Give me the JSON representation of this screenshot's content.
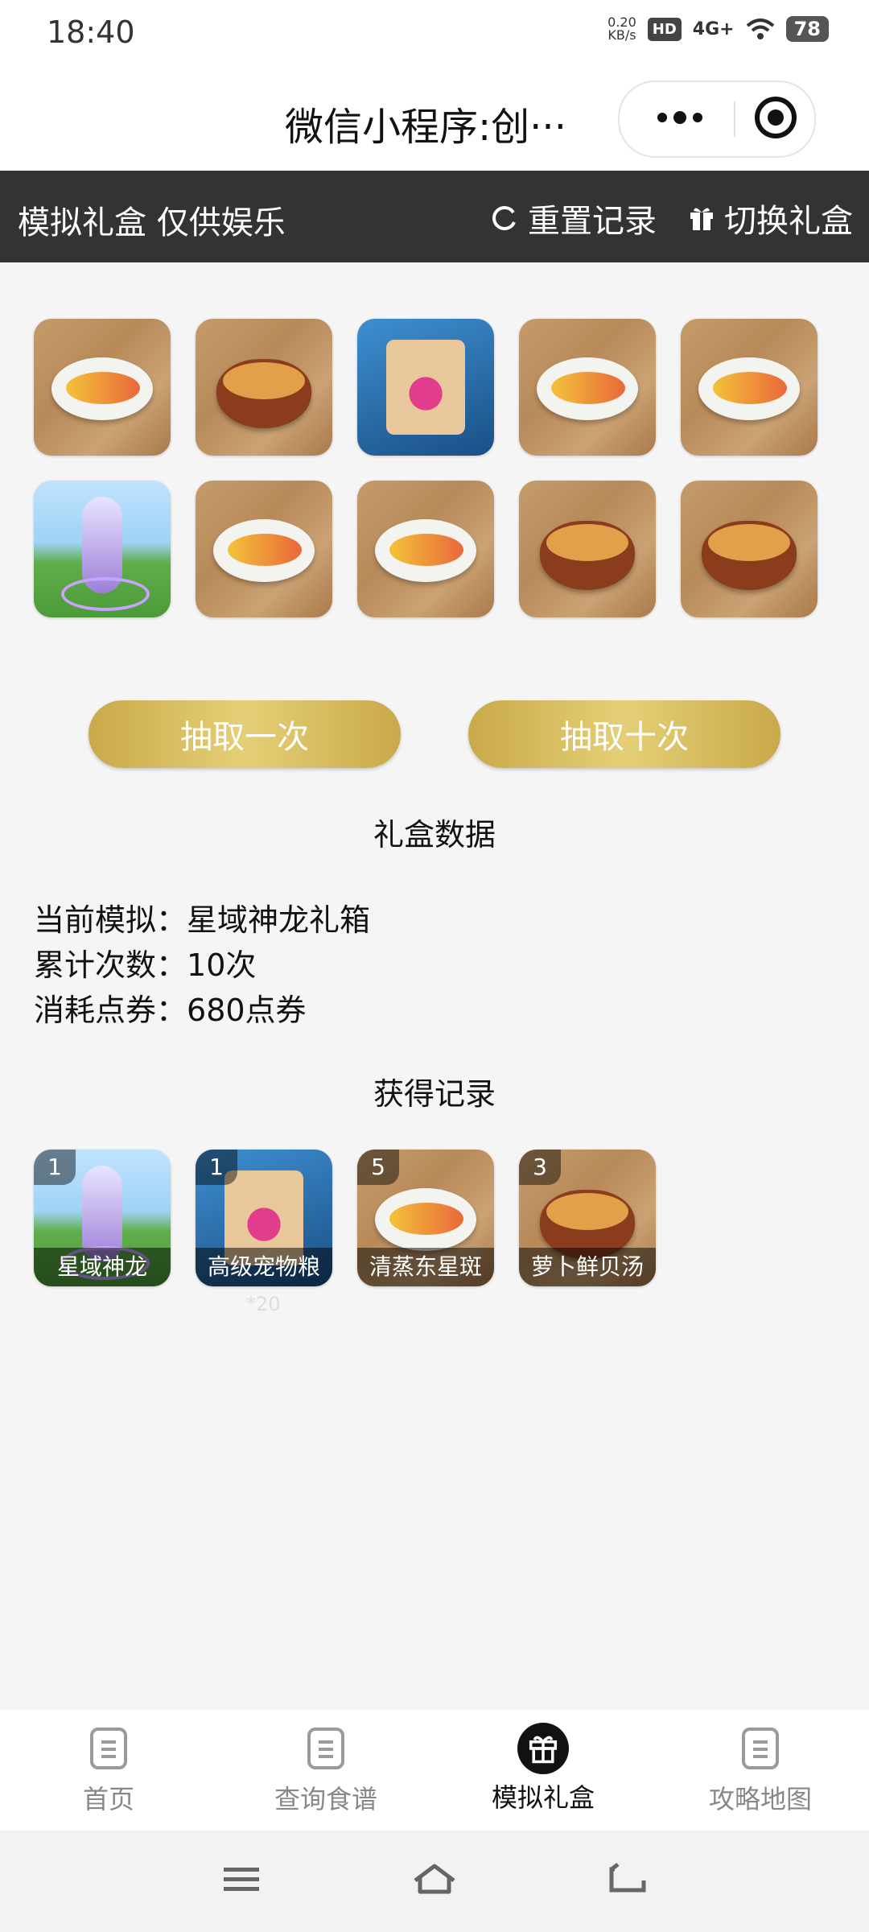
{
  "status_bar": {
    "time": "18:40",
    "net_speed": "0.20",
    "net_unit": "KB/s",
    "hd": "HD",
    "signal": "4G+",
    "battery": "78"
  },
  "titlebar": {
    "title": "微信小程序:创···"
  },
  "header": {
    "label": "模拟礼盒 仅供娱乐",
    "reset_label": "重置记录",
    "switch_label": "切换礼盒"
  },
  "draw_results": [
    {
      "item": "清蒸东星斑"
    },
    {
      "item": "萝卜鲜贝汤"
    },
    {
      "item": "高级宠物粮"
    },
    {
      "item": "清蒸东星斑"
    },
    {
      "item": "清蒸东星斑"
    },
    {
      "item": "星域神龙"
    },
    {
      "item": "清蒸东星斑"
    },
    {
      "item": "清蒸东星斑"
    },
    {
      "item": "萝卜鲜贝汤"
    },
    {
      "item": "萝卜鲜贝汤"
    }
  ],
  "buttons": {
    "draw_once": "抽取一次",
    "draw_ten": "抽取十次"
  },
  "stats": {
    "title": "礼盒数据",
    "current_label": "当前模拟：",
    "current_value": "星域神龙礼箱",
    "count_label": "累计次数：",
    "count_value": "10次",
    "cost_label": "消耗点券：",
    "cost_value": "680点券"
  },
  "records": {
    "title": "获得记录",
    "items": [
      {
        "count": "1",
        "name": "星域神龙",
        "sub": ""
      },
      {
        "count": "1",
        "name": "高级宠物粮",
        "sub": "*20"
      },
      {
        "count": "5",
        "name": "清蒸东星斑",
        "sub": ""
      },
      {
        "count": "3",
        "name": "萝卜鲜贝汤",
        "sub": ""
      }
    ]
  },
  "tabbar": {
    "tabs": [
      {
        "label": "首页"
      },
      {
        "label": "查询食谱"
      },
      {
        "label": "模拟礼盒"
      },
      {
        "label": "攻略地图"
      }
    ]
  },
  "colors": {
    "header_bg": "#333333",
    "gold": "#d4b75c",
    "active_tab": "#111111"
  }
}
